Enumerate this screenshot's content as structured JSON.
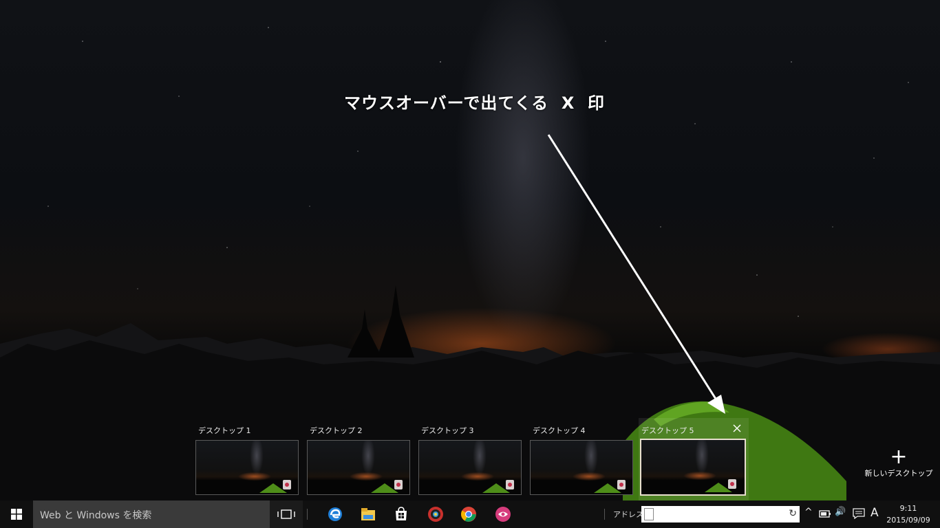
{
  "annotation": {
    "text": "マウスオーバーで出てくる  X  印"
  },
  "desktops": [
    {
      "label": "デスクトップ 1"
    },
    {
      "label": "デスクトップ 2"
    },
    {
      "label": "デスクトップ 3"
    },
    {
      "label": "デスクトップ 4"
    },
    {
      "label": "デスクトップ 5"
    }
  ],
  "new_desktop": {
    "plus": "+",
    "label": "新しいデスクトップ"
  },
  "taskbar": {
    "search_placeholder": "Web と Windows を検索",
    "pinned_icons": [
      "edge-icon",
      "file-explorer-icon",
      "store-icon",
      "media-player-icon",
      "chrome-icon",
      "app-icon"
    ],
    "address_label": "アドレス",
    "refresh_glyph": "↻",
    "tray": {
      "chevron": "^",
      "volume": "🔊",
      "ime": "A"
    },
    "clock": {
      "time": "9:11",
      "date": "2015/09/09"
    }
  },
  "colors": {
    "taskbar": "#101010",
    "search_box": "#3a3a3a",
    "selected_border": "#e9e0cf",
    "tent_green": "#4e8d19"
  }
}
